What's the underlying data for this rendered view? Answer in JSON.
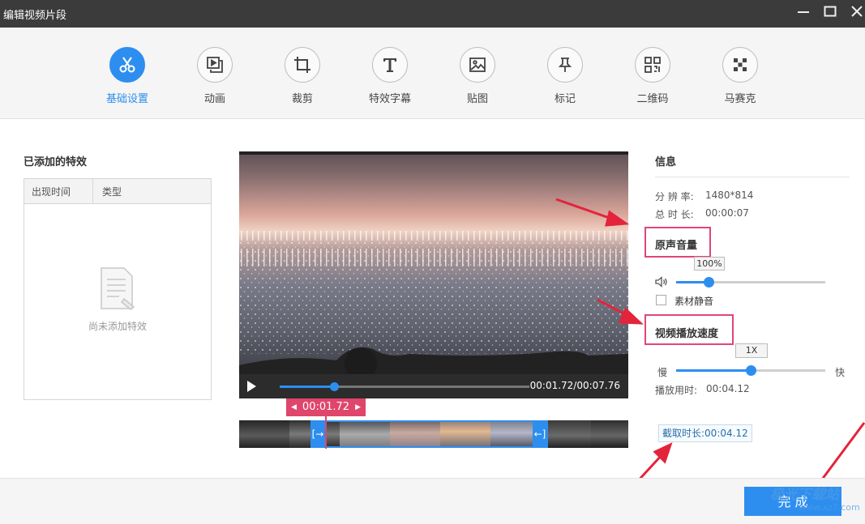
{
  "window": {
    "title": "编辑视频片段",
    "minimize_icon": "minimize-icon",
    "maximize_icon": "maximize-icon",
    "close_icon": "close-icon"
  },
  "toolbar": {
    "items": [
      {
        "label": "基础设置",
        "icon": "scissors-icon",
        "active": true
      },
      {
        "label": "动画",
        "icon": "animation-icon",
        "active": false
      },
      {
        "label": "裁剪",
        "icon": "crop-icon",
        "active": false
      },
      {
        "label": "特效字幕",
        "icon": "text-t-icon",
        "active": false
      },
      {
        "label": "贴图",
        "icon": "image-icon",
        "active": false
      },
      {
        "label": "标记",
        "icon": "pin-icon",
        "active": false
      },
      {
        "label": "二维码",
        "icon": "qrcode-icon",
        "active": false
      },
      {
        "label": "马赛克",
        "icon": "mosaic-icon",
        "active": false
      }
    ]
  },
  "effects_panel": {
    "title": "已添加的特效",
    "columns": [
      "出现时间",
      "类型"
    ],
    "empty_text": "尚未添加特效"
  },
  "player": {
    "time": "00:01.72/00:07.76",
    "progress": 0.22,
    "cursor_time": "00:01.72"
  },
  "info": {
    "title": "信息",
    "resolution_label": "分 辨 率:",
    "resolution_value": "1480*814",
    "duration_label": "总 时 长:",
    "duration_value": "00:00:07"
  },
  "volume": {
    "title": "原声音量",
    "value_label": "100%",
    "level": 0.22,
    "mute_label": "素材静音",
    "mute_checked": false
  },
  "speed": {
    "title": "视频播放速度",
    "value_label": "1X",
    "level": 0.5,
    "slow_label": "慢",
    "fast_label": "快",
    "playtime_label": "播放用时:",
    "playtime_value": "00:04.12"
  },
  "clip_length": "截取时长:00:04.12",
  "done_button": "完 成",
  "watermark": {
    "main": "极光下载站",
    "sub": "www.xz7.com"
  },
  "colors": {
    "accent": "#2d8ef0",
    "highlight": "#e0457a",
    "titlebar": "#3b3b3b"
  }
}
